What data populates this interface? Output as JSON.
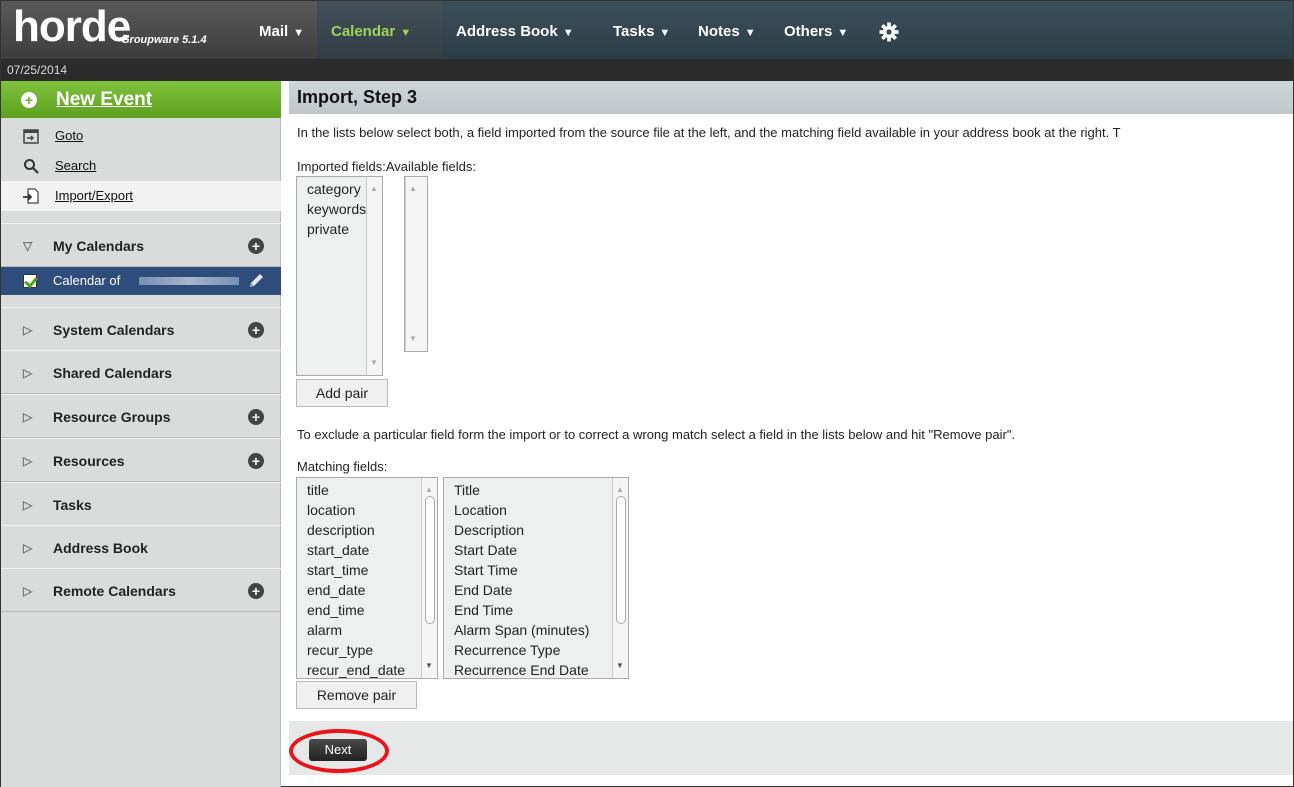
{
  "app": {
    "logo": "horde",
    "logo_sub": "Groupware 5.1.4",
    "date": "07/25/2014"
  },
  "menu": {
    "mail": "Mail",
    "calendar": "Calendar",
    "address_book": "Address Book",
    "tasks": "Tasks",
    "notes": "Notes",
    "others": "Others",
    "settings_icon": "gear-icon"
  },
  "sidebar": {
    "new_event": "New Event",
    "links": {
      "goto": "Goto",
      "search": "Search",
      "import_export": "Import/Export"
    },
    "my_calendars": "My Calendars",
    "calendar_item": "Calendar of",
    "sections": {
      "system": "System Calendars",
      "shared": "Shared Calendars",
      "resource_groups": "Resource Groups",
      "resources": "Resources",
      "tasks": "Tasks",
      "address_book": "Address Book",
      "remote": "Remote Calendars"
    }
  },
  "main": {
    "title": "Import, Step 3",
    "instructions": "In the lists below select both, a field imported from the source file at the left, and the matching field available in your address book at the right. T",
    "imported_label": "Imported fields:",
    "available_label": "Available fields:",
    "imported_fields": [
      "category",
      "keywords",
      "private"
    ],
    "available_fields": [],
    "add_pair": "Add pair",
    "exclude_text": "To exclude a particular field form the import or to correct a wrong match select a field in the lists below and hit \"Remove pair\".",
    "matching_label": "Matching fields:",
    "matching_left": [
      "title",
      "location",
      "description",
      "start_date",
      "start_time",
      "end_date",
      "end_time",
      "alarm",
      "recur_type",
      "recur_end_date"
    ],
    "matching_right": [
      "Title",
      "Location",
      "Description",
      "Start Date",
      "Start Time",
      "End Date",
      "End Time",
      "Alarm Span (minutes)",
      "Recurrence Type",
      "Recurrence End Date"
    ],
    "remove_pair": "Remove pair",
    "next": "Next"
  },
  "colors": {
    "accent_green": "#6fae2c",
    "highlight_red": "#e8141c",
    "selected_calendar": "#2f4d7a"
  }
}
